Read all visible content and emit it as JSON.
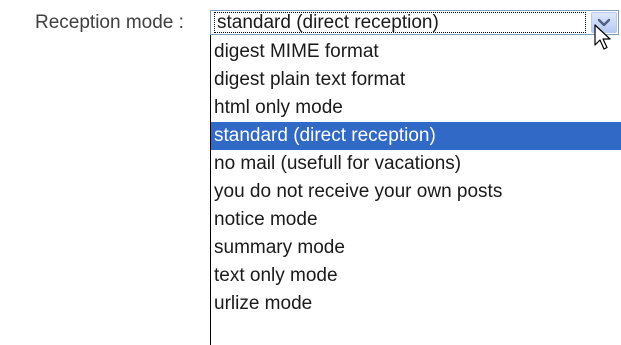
{
  "form": {
    "label": "Reception mode :",
    "selected_value": "standard (direct reception)",
    "options": [
      {
        "label": "digest MIME format",
        "selected": false
      },
      {
        "label": "digest plain text format",
        "selected": false
      },
      {
        "label": "html only mode",
        "selected": false
      },
      {
        "label": "standard (direct reception)",
        "selected": true
      },
      {
        "label": "no mail (usefull for vacations)",
        "selected": false
      },
      {
        "label": "you do not receive your own posts",
        "selected": false
      },
      {
        "label": "notice mode",
        "selected": false
      },
      {
        "label": "summary mode",
        "selected": false
      },
      {
        "label": "text only mode",
        "selected": false
      },
      {
        "label": "urlize mode",
        "selected": false
      }
    ]
  },
  "icons": {
    "dropdown": "chevron-down-icon",
    "cursor": "mouse-pointer-icon"
  },
  "colors": {
    "highlight": "#3169c6",
    "border": "#7f9db9",
    "button": "#b7c9f5"
  }
}
